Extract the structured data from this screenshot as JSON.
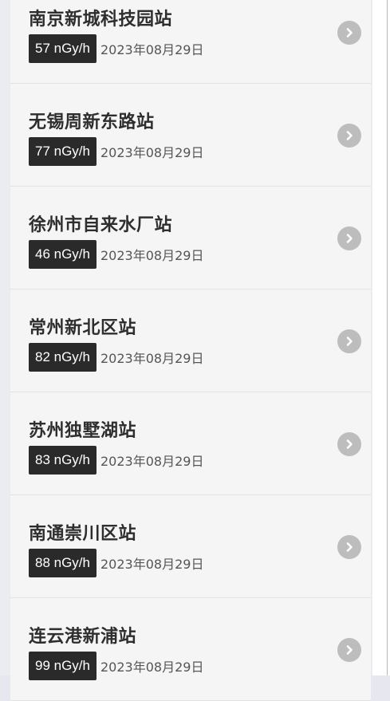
{
  "stations": [
    {
      "name": "南京新城科技园站",
      "dose": "57 nGy/h",
      "date": "2023年08月29日"
    },
    {
      "name": "无锡周新东路站",
      "dose": "77 nGy/h",
      "date": "2023年08月29日"
    },
    {
      "name": "徐州市自来水厂站",
      "dose": "46 nGy/h",
      "date": "2023年08月29日"
    },
    {
      "name": "常州新北区站",
      "dose": "82 nGy/h",
      "date": "2023年08月29日"
    },
    {
      "name": "苏州独墅湖站",
      "dose": "83 nGy/h",
      "date": "2023年08月29日"
    },
    {
      "name": "南通崇川区站",
      "dose": "88 nGy/h",
      "date": "2023年08月29日"
    },
    {
      "name": "连云港新浦站",
      "dose": "99 nGy/h",
      "date": "2023年08月29日"
    }
  ],
  "colors": {
    "badge_bg": "#2a2a2a",
    "item_bg": "#f5f5f5",
    "chevron_bg": "#bdbdbd"
  },
  "icons": {
    "item_action": "chevron-right-circle-icon"
  }
}
